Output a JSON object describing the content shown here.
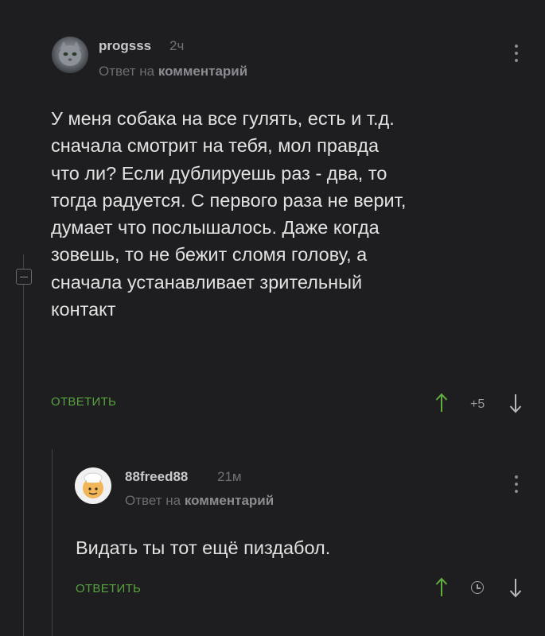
{
  "comment1": {
    "author": "progsss",
    "time": "2ч",
    "reply_prefix": "Ответ на",
    "reply_target": "комментарий",
    "text": "У меня собака на все гулять, есть и т.д.\nсначала смотрит на тебя, мол правда\nчто ли? Если дублируешь раз - два, то\nтогда радуется. С первого раза не верит,\nдумает что послышалось. Даже когда\nзовешь, то не бежит сломя голову, а\nсначала устанавливает зрительный\nконтакт",
    "reply_label": "ОТВЕТИТЬ",
    "score": "+5",
    "upvote_icon": "arrow-up-icon",
    "downvote_icon": "arrow-down-icon"
  },
  "comment2": {
    "author": "88freed88",
    "time": "21м",
    "reply_prefix": "Ответ на",
    "reply_target": "комментарий",
    "text": "Видать ты тот ещё пиздабол.",
    "reply_label": "ОТВЕТИТЬ",
    "score_icon": "clock-icon"
  },
  "colors": {
    "background": "#1e1e20",
    "accent_green": "#58a23f",
    "text": "#e2e2e2"
  }
}
